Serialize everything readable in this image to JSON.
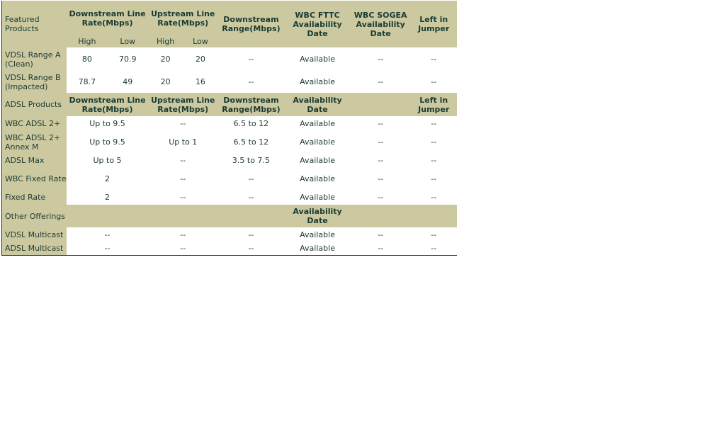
{
  "featured": {
    "headers": [
      "Featured Products",
      "Downstream Line Rate(Mbps)",
      "Upstream Line Rate(Mbps)",
      "Downstream Range(Mbps)",
      "WBC FTTC Availability Date",
      "WBC SOGEA Availability Date",
      "Left in Jumper"
    ],
    "sub": [
      "High",
      "Low",
      "High",
      "Low"
    ],
    "rows": [
      [
        "VDSL Range A (Clean)",
        "80",
        "70.9",
        "20",
        "20",
        "--",
        "Available",
        "--",
        "--"
      ],
      [
        "VDSL Range B (Impacted)",
        "78.7",
        "49",
        "20",
        "16",
        "--",
        "Available",
        "--",
        "--"
      ]
    ]
  },
  "adsl": {
    "headers": [
      "ADSL Products",
      "Downstream Line Rate(Mbps)",
      "Upstream Line Rate(Mbps)",
      "Downstream Range(Mbps)",
      "Availability Date",
      "",
      "Left in Jumper"
    ],
    "rows": [
      [
        "WBC ADSL 2+",
        "Up to 9.5",
        "--",
        "6.5 to 12",
        "Available",
        "--",
        "--"
      ],
      [
        "WBC ADSL 2+ Annex M",
        "Up to 9.5",
        "Up to 1",
        "6.5 to 12",
        "Available",
        "--",
        "--"
      ],
      [
        "ADSL Max",
        "Up to 5",
        "--",
        "3.5 to 7.5",
        "Available",
        "--",
        "--"
      ],
      [
        "WBC Fixed Rate",
        "2",
        "--",
        "--",
        "Available",
        "--",
        "--"
      ],
      [
        "Fixed Rate",
        "2",
        "--",
        "--",
        "Available",
        "--",
        "--"
      ]
    ]
  },
  "other": {
    "headers": [
      "Other Offerings",
      "",
      "",
      "",
      "Availability Date",
      "",
      ""
    ],
    "rows": [
      [
        "VDSL Multicast",
        "--",
        "--",
        "--",
        "Available",
        "--",
        "--"
      ],
      [
        "ADSL Multicast",
        "--",
        "--",
        "--",
        "Available",
        "--",
        "--"
      ]
    ]
  }
}
